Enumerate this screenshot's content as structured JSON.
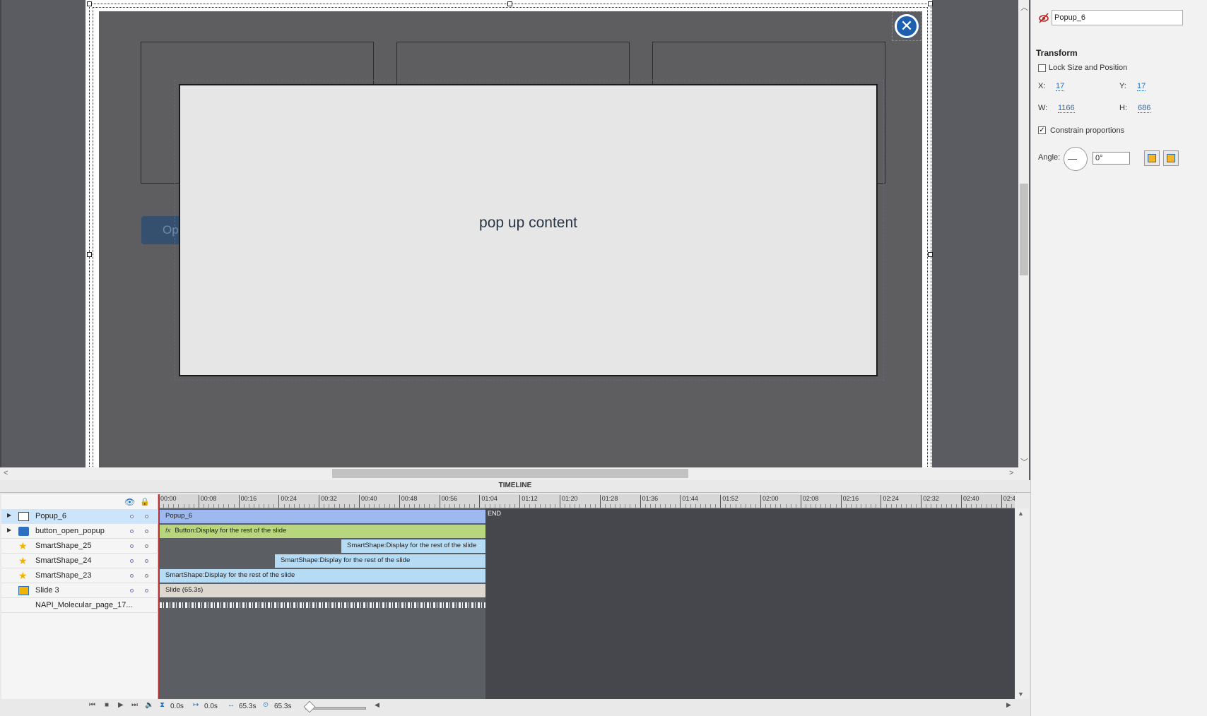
{
  "stage": {
    "popup_text": "pop up content",
    "open_button_label": "Ope",
    "close_icon": "close-icon"
  },
  "properties": {
    "object_name": "Popup_6",
    "visibility_icon": "visibility-icon",
    "transform_title": "Transform",
    "lock_label": "Lock Size and Position",
    "lock_checked": false,
    "x_label": "X:",
    "x_value": "17",
    "y_label": "Y:",
    "y_value": "17",
    "w_label": "W:",
    "w_value": "1166",
    "h_label": "H:",
    "h_value": "686",
    "constrain_label": "Constrain proportions",
    "constrain_checked": true,
    "angle_label": "Angle:",
    "angle_value": "0°"
  },
  "timeline": {
    "title": "TIMELINE",
    "ruler": [
      "00:00",
      "00:08",
      "00:16",
      "00:24",
      "00:32",
      "00:40",
      "00:48",
      "00:56",
      "01:04",
      "01:12",
      "01:20",
      "01:28",
      "01:36",
      "01:44",
      "01:52",
      "02:00",
      "02:08",
      "02:16",
      "02:24",
      "02:32",
      "02:40",
      "02:4"
    ],
    "end_label": "END",
    "layers": [
      {
        "name": "Popup_6",
        "icon": "popup-icon",
        "bar": "Popup_6",
        "selected": true
      },
      {
        "name": "button_open_popup",
        "icon": "button-icon",
        "bar": "Button:Display for the rest of the slide",
        "fx": "fx"
      },
      {
        "name": "SmartShape_25",
        "icon": "star-icon",
        "bar": "SmartShape:Display for the rest of the slide"
      },
      {
        "name": "SmartShape_24",
        "icon": "star-icon",
        "bar": "SmartShape:Display for the rest of the slide"
      },
      {
        "name": "SmartShape_23",
        "icon": "star-icon",
        "bar": "SmartShape:Display for the rest of the slide"
      },
      {
        "name": "Slide 3",
        "icon": "slide-icon",
        "bar": "Slide (65.3s)"
      },
      {
        "name": "NAPI_Molecular_page_17...",
        "icon": "",
        "bar": ""
      }
    ],
    "footer": {
      "current_time": "0.0s",
      "start_time": "0.0s",
      "duration": "65.3s",
      "end_time": "65.3s"
    }
  },
  "colors": {
    "popup_bar": "#9db9ef",
    "button_bar": "#b7d67d",
    "shape_bar": "#b6dcf5",
    "slide_bar": "#dcd8cf",
    "close_button": "#1c5fae"
  }
}
